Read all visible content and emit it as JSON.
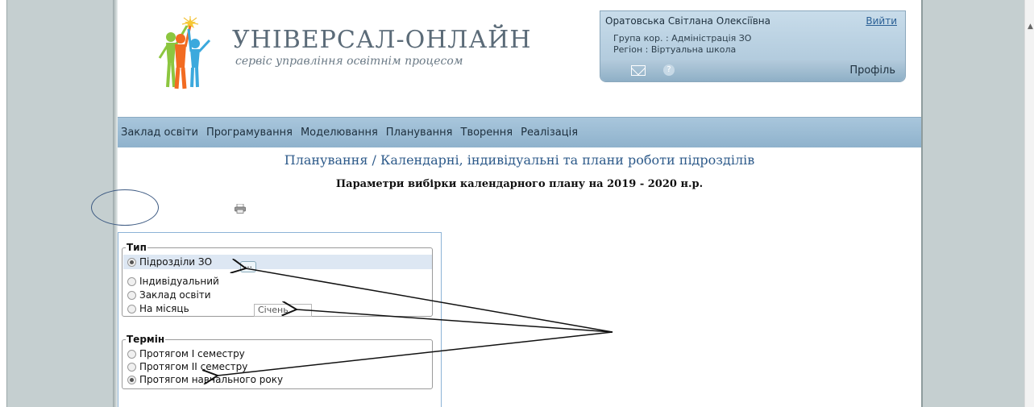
{
  "brand": {
    "title": "УНІВЕРСАЛ-ОНЛАЙН",
    "subtitle": "сервіс управління освітнім процесом"
  },
  "user": {
    "name": "Оратовська Світлана Олексіївна",
    "logout": "Вийти",
    "group": "Група кор. : Адміністрація ЗО",
    "region": "Регіон : Віртуальна школа",
    "help": "?",
    "profile": "Профіль"
  },
  "menu": [
    "Заклад освіти",
    "Програмування",
    "Моделювання",
    "Планування",
    "Творення",
    "Реалізація"
  ],
  "page": {
    "title": "Планування / Календарні, індивідуальні та плани роботи підрозділів",
    "subtitle": "Параметри вибірки календарного плану на 2019 - 2020 н.р."
  },
  "type_group": {
    "legend": "Тип",
    "options": [
      "Підрозділи ЗО",
      "Індивідуальний",
      "Заклад освіти",
      "На місяць"
    ],
    "selected": "Підрозділи ЗО",
    "dots_button": "...",
    "month_value": "Січень"
  },
  "term_group": {
    "legend": "Термін",
    "options": [
      "Протягом I семестру",
      "Протягом II семестру",
      "Протягом навчального року"
    ],
    "selected": "Протягом навчального року"
  },
  "icons": [
    "logo-icon",
    "mail-icon",
    "help-icon",
    "printer-icon"
  ],
  "colors": {
    "menu_bar": "#9fbfd6",
    "user_panel": "#b8d0e2",
    "title_text": "#2d5a8a",
    "side_background": "#c5cfd0"
  }
}
